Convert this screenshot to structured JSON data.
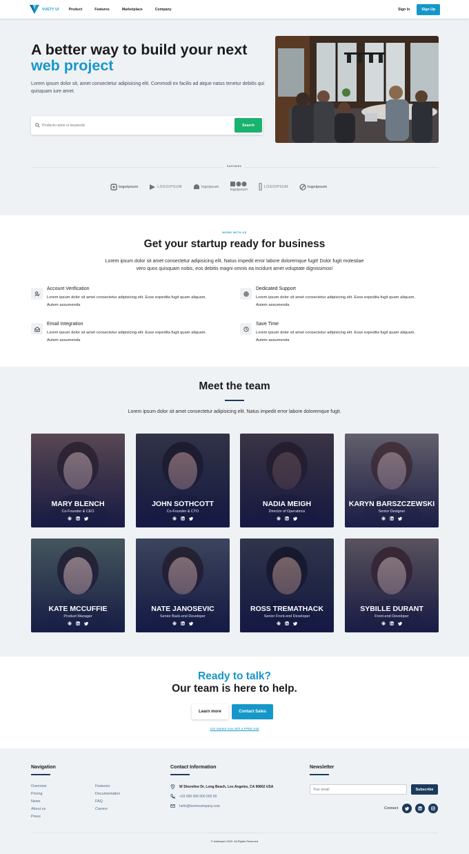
{
  "header": {
    "brand": "VUETY UI",
    "nav": [
      "Product",
      "Features",
      "Marketplace",
      "Company"
    ],
    "sign_in": "Sign In",
    "sign_up": "Sign Up"
  },
  "hero": {
    "title_line1": "A better way to build your next",
    "title_line2": "web project",
    "description": "Lorem ipsum dolor sit, amet consectetur adipisicing elit. Commodi ex facilis ad atque natus tenetur debitis qui quisquam iure amet.",
    "search_placeholder": "Products name or keywords",
    "search_button": "Search"
  },
  "partners": {
    "label": "PARTNERS",
    "logos": [
      "logoipsum",
      "LOGOIPSUM",
      "logoipsum",
      "logoipsum",
      "LOGOIPSUM",
      "logoipsum"
    ]
  },
  "work": {
    "eyebrow": "WORK WITH US",
    "title": "Get your startup ready for business",
    "description": "Lorem ipsum dolor sit amet consectetur adipisicing elit. Natus impedit error labore doloremque fugit! Dolor fugit molestiae vero quos quisquam nobis, eos debitis magni omnis ea incidunt amet voluptate dignissimos!",
    "features": [
      {
        "title": "Account Verification",
        "desc": "Lorem ipsum dolor sit amet consectetur adipisicing elit. Esse expedita fugit quam aliquam. Autem assumenda"
      },
      {
        "title": "Dedicated Support",
        "desc": "Lorem ipsum dolor sit amet consectetur adipisicing elit. Esse expedita fugit quam aliquam. Autem assumenda"
      },
      {
        "title": "Email Integration",
        "desc": "Lorem ipsum dolor sit amet consectetur adipisicing elit. Esse expedita fugit quam aliquam. Autem assumenda"
      },
      {
        "title": "Save Time",
        "desc": "Lorem ipsum dolor sit amet consectetur adipisicing elit. Esse expedita fugit quam aliquam. Autem assumenda"
      }
    ]
  },
  "team": {
    "title": "Meet the team",
    "description": "Lorem ipsum dolor sit amet consectetur adipisicing elit. Natus impedit error labore doloremque fugit.",
    "members": [
      {
        "name": "MARY BLENCH",
        "role": "Co-Founder & CEO"
      },
      {
        "name": "JOHN SOTHCOTT",
        "role": "Co-Founder & CTO"
      },
      {
        "name": "NADIA MEIGH",
        "role": "Director of Operations"
      },
      {
        "name": "KARYN BARSZCZEWSKI",
        "role": "Senior Designer"
      },
      {
        "name": "KATE MCCUFFIE",
        "role": "Product Manager"
      },
      {
        "name": "NATE JANOSEVIC",
        "role": "Senior Back-end Developer"
      },
      {
        "name": "ROSS TREMATHACK",
        "role": "Senior Front-end Developer"
      },
      {
        "name": "SYBILLE DURANT",
        "role": "Front-end Developer"
      }
    ]
  },
  "cta": {
    "line1": "Ready to talk?",
    "line2": "Our team is here to help.",
    "learn_more": "Learn more",
    "contact_sales": "Contact Sales",
    "trial_link": "Get started now with a FREE trial"
  },
  "footer": {
    "nav_title": "Navigation",
    "nav_col1": [
      "Overview",
      "Pricing",
      "News",
      "About us",
      "Press"
    ],
    "nav_col2": [
      "Features",
      "Documentation",
      "FAQ",
      "Carrers"
    ],
    "contact_title": "Contact Information",
    "address": "W Shoreline Dr, Long Beach, Los Angeles, CA 90802 USA",
    "phone": "+03 000 000 000 555 55",
    "email": "hello@loremcompany.com",
    "newsletter_title": "Newsletter",
    "email_placeholder": "Your email",
    "subscribe": "Subscribe",
    "connect": "Connect",
    "copyright": "© Indielayer 2020. All Rights Reserved"
  },
  "colors": {
    "accent": "#1697c9",
    "search_green": "#19b26e",
    "navy": "#1a3a5c",
    "section_bg": "#eff2f5"
  }
}
